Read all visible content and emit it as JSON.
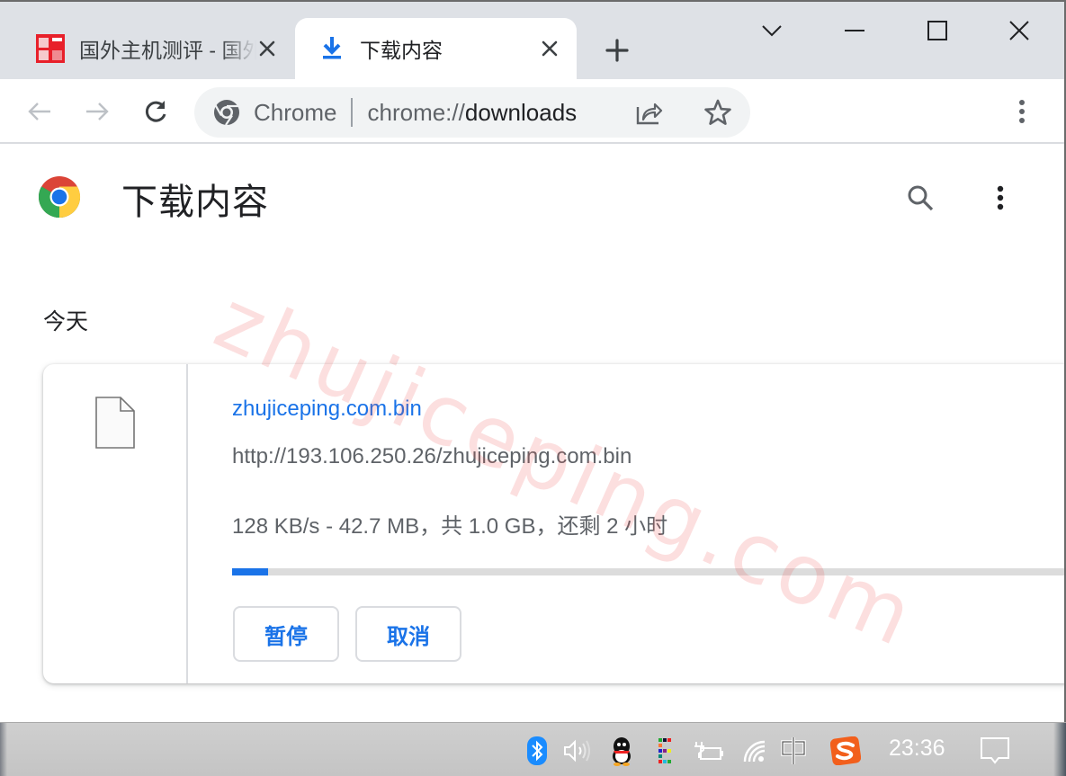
{
  "browser": {
    "tabs": [
      {
        "title": "国外主机测评 - 国外VPS",
        "favicon": "site-favicon",
        "active": false
      },
      {
        "title": "下载内容",
        "favicon": "download-icon",
        "active": true
      }
    ],
    "new_tab_label": "+",
    "window_controls": [
      "tab-search-chevron",
      "minimize",
      "maximize",
      "close"
    ],
    "omnibox": {
      "site_label": "Chrome",
      "url_scheme": "chrome://",
      "url_host": "downloads"
    }
  },
  "page": {
    "title": "下载内容",
    "date_header": "今天",
    "watermark": "zhujiceping.com",
    "downloads": [
      {
        "file_name": "zhujiceping.com.bin",
        "url": "http://193.106.250.26/zhujiceping.com.bin",
        "status": "128 KB/s - 42.7 MB，共 1.0 GB，还剩 2 小时",
        "progress_percent": 4.2,
        "buttons": {
          "pause": "暂停",
          "cancel": "取消"
        }
      }
    ]
  },
  "taskbar": {
    "tray_icons": [
      "bluetooth",
      "volume",
      "qq",
      "color-e-app",
      "power-battery",
      "wifi",
      "ime-chinese",
      "sogou-input"
    ],
    "ime_label": "中",
    "clock": "23:36"
  },
  "colors": {
    "accent": "#1a73e8",
    "tabstrip": "#dee1e6",
    "omnibox": "#f1f3f4",
    "progress_track": "#dcdcdc"
  }
}
